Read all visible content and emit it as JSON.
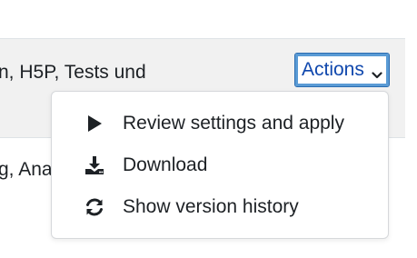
{
  "header": {
    "title_fragment": "n, H5P, Tests und"
  },
  "actions": {
    "label": "Actions",
    "chevron_icon": "chevron-down-icon"
  },
  "body": {
    "text_fragment": "g, Ana"
  },
  "menu": {
    "items": [
      {
        "label": "Review settings and apply",
        "icon": "play-icon"
      },
      {
        "label": "Download",
        "icon": "download-icon"
      },
      {
        "label": "Show version history",
        "icon": "refresh-icon"
      }
    ]
  },
  "colors": {
    "link": "#0f47ad",
    "focus_border": "#5a9bd5",
    "header_bg": "#f1f1f1",
    "text": "#1d2125"
  }
}
